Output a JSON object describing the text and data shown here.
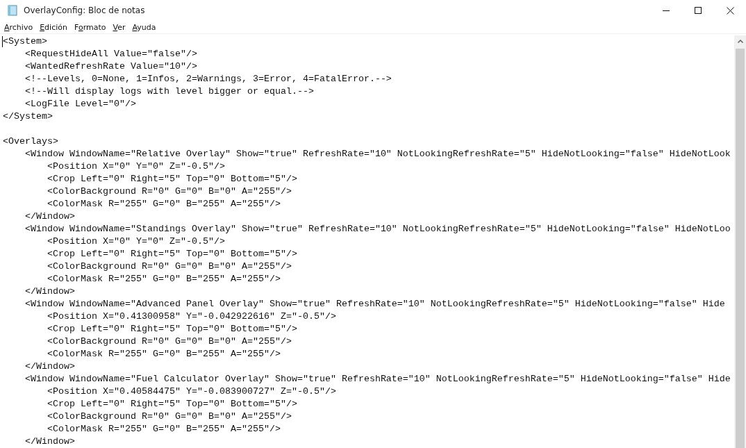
{
  "window": {
    "title": "OverlayConfig: Bloc de notas"
  },
  "menu": [
    {
      "accesskey": "A",
      "after": "rchivo"
    },
    {
      "accesskey": "E",
      "after": "dición"
    },
    {
      "before": "F",
      "accesskey": "o",
      "after": "rmato"
    },
    {
      "accesskey": "V",
      "after": "er"
    },
    {
      "accesskey": "A",
      "after": "yuda"
    }
  ],
  "editor": {
    "lines": [
      {
        "kind": "text",
        "text": "<System>"
      },
      {
        "kind": "text",
        "text": "    <RequestHideAll Value=\"false\"/>"
      },
      {
        "kind": "text",
        "text": "    <WantedRefreshRate Value=\"10\"/>"
      },
      {
        "kind": "text",
        "text": "    <!--Levels, 0=None, 1=Infos, 2=Warnings, 3=Error, 4=FatalError.-->"
      },
      {
        "kind": "text",
        "text": "    <!--Will display logs with level bigger or equal.-->"
      },
      {
        "kind": "text",
        "text": "    <LogFile Level=\"0\"/>"
      },
      {
        "kind": "text",
        "text": "</System>"
      },
      {
        "kind": "blank"
      },
      {
        "kind": "text",
        "text": "<Overlays>"
      },
      {
        "kind": "text",
        "text": "    <Window WindowName=\"Relative Overlay\" Show=\"true\" RefreshRate=\"10\" NotLookingRefreshRate=\"5\" HideNotLooking=\"false\" HideNotLook"
      },
      {
        "kind": "text",
        "text": "        <Position X=\"0\" Y=\"0\" Z=\"-0.5\"/>"
      },
      {
        "kind": "text",
        "text": "        <Crop Left=\"0\" Right=\"5\" Top=\"0\" Bottom=\"5\"/>"
      },
      {
        "kind": "text",
        "text": "        <ColorBackground R=\"0\" G=\"0\" B=\"0\" A=\"255\"/>"
      },
      {
        "kind": "text",
        "text": "        <ColorMask R=\"255\" G=\"0\" B=\"255\" A=\"255\"/>"
      },
      {
        "kind": "text",
        "text": "    </Window>"
      },
      {
        "kind": "text",
        "text": "    <Window WindowName=\"Standings Overlay\" Show=\"true\" RefreshRate=\"10\" NotLookingRefreshRate=\"5\" HideNotLooking=\"false\" HideNotLoo"
      },
      {
        "kind": "text",
        "text": "        <Position X=\"0\" Y=\"0\" Z=\"-0.5\"/>"
      },
      {
        "kind": "text",
        "text": "        <Crop Left=\"0\" Right=\"5\" Top=\"0\" Bottom=\"5\"/>"
      },
      {
        "kind": "text",
        "text": "        <ColorBackground R=\"0\" G=\"0\" B=\"0\" A=\"255\"/>"
      },
      {
        "kind": "text",
        "text": "        <ColorMask R=\"255\" G=\"0\" B=\"255\" A=\"255\"/>"
      },
      {
        "kind": "text",
        "text": "    </Window>"
      },
      {
        "kind": "text",
        "text": "    <Window WindowName=\"Advanced Panel Overlay\" Show=\"true\" RefreshRate=\"10\" NotLookingRefreshRate=\"5\" HideNotLooking=\"false\" Hide"
      },
      {
        "kind": "text",
        "text": "        <Position X=\"0.41300958\" Y=\"-0.042922616\" Z=\"-0.5\"/>"
      },
      {
        "kind": "text",
        "text": "        <Crop Left=\"0\" Right=\"5\" Top=\"0\" Bottom=\"5\"/>"
      },
      {
        "kind": "text",
        "text": "        <ColorBackground R=\"0\" G=\"0\" B=\"0\" A=\"255\"/>"
      },
      {
        "kind": "text",
        "text": "        <ColorMask R=\"255\" G=\"0\" B=\"255\" A=\"255\"/>"
      },
      {
        "kind": "text",
        "text": "    </Window>"
      },
      {
        "kind": "text",
        "text": "    <Window WindowName=\"Fuel Calculator Overlay\" Show=\"true\" RefreshRate=\"10\" NotLookingRefreshRate=\"5\" HideNotLooking=\"false\" Hide"
      },
      {
        "kind": "text",
        "text": "        <Position X=\"0.40584475\" Y=\"-0.083900727\" Z=\"-0.5\"/>"
      },
      {
        "kind": "text",
        "text": "        <Crop Left=\"0\" Right=\"5\" Top=\"0\" Bottom=\"5\"/>"
      },
      {
        "kind": "text",
        "text": "        <ColorBackground R=\"0\" G=\"0\" B=\"0\" A=\"255\"/>"
      },
      {
        "kind": "text",
        "text": "        <ColorMask R=\"255\" G=\"0\" B=\"255\" A=\"255\"/>"
      },
      {
        "kind": "text",
        "text": "    </Window>"
      }
    ]
  }
}
